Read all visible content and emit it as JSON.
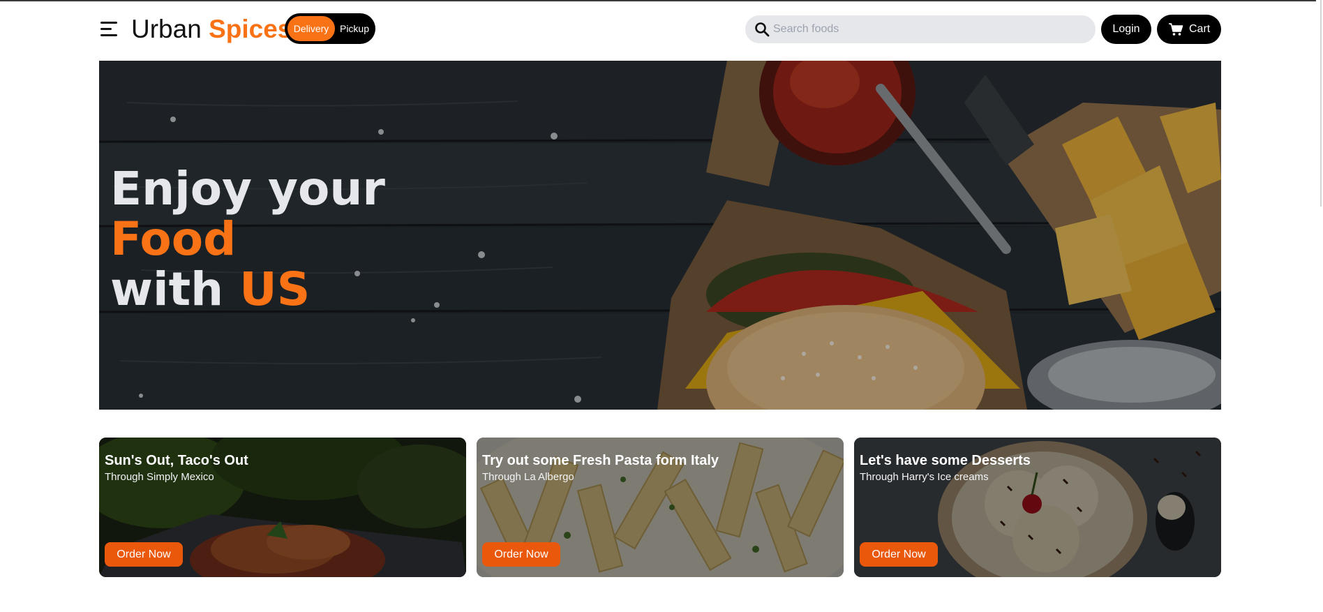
{
  "header": {
    "brand_part1": "Urban",
    "brand_part2": "Spices",
    "mode_toggle": {
      "options": [
        "Delivery",
        "Pickup"
      ],
      "selected": "Delivery"
    },
    "search_placeholder": "Search foods",
    "login_label": "Login",
    "cart_label": "Cart"
  },
  "hero": {
    "line1": "Enjoy your",
    "line2": "Food",
    "line3_part1": "with",
    "line3_part2": "US"
  },
  "cards": [
    {
      "title": "Sun's Out, Taco's Out",
      "subtitle": "Through Simply Mexico",
      "button": "Order Now"
    },
    {
      "title": "Try out some Fresh Pasta form Italy",
      "subtitle": "Through La Albergo",
      "button": "Order Now"
    },
    {
      "title": "Let's have some Desserts",
      "subtitle": "Through Harry's Ice creams",
      "button": "Order Now"
    }
  ],
  "colors": {
    "accent": "#f97316",
    "button_accent": "#ea580c",
    "dark": "#000000",
    "search_bg": "#e5e7eb"
  },
  "icons": {
    "menu": "hamburger-menu-icon",
    "search": "search-icon",
    "cart": "shopping-cart-icon"
  }
}
